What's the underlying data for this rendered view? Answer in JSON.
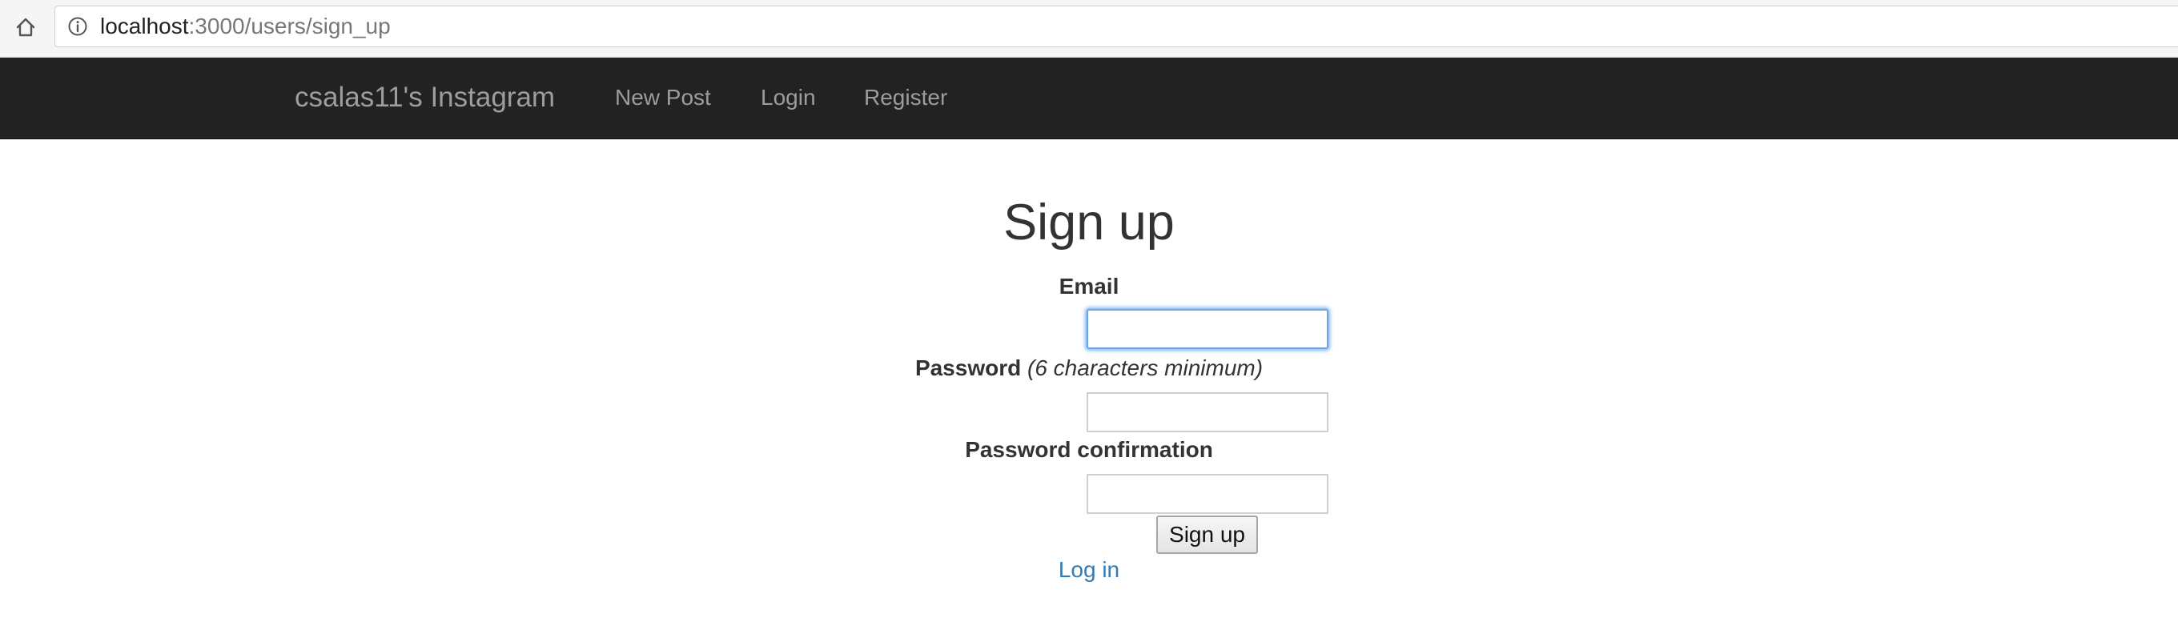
{
  "browser": {
    "url_host": "localhost",
    "url_path": ":3000/users/sign_up",
    "icons": {
      "home": "home-icon",
      "info": "info-icon"
    }
  },
  "navbar": {
    "brand": "csalas11's Instagram",
    "links": [
      "New Post",
      "Login",
      "Register"
    ],
    "background": "#222222",
    "link_color": "#9d9d9d"
  },
  "form": {
    "title": "Sign up",
    "email_label": "Email",
    "email_value": "",
    "password_label": "Password",
    "password_hint": "(6 characters minimum)",
    "password_value": "",
    "password_confirmation_label": "Password confirmation",
    "password_confirmation_value": "",
    "submit_label": "Sign up",
    "login_link": "Log in",
    "link_color": "#337ab7",
    "focus_color": "#6aa6e8"
  }
}
